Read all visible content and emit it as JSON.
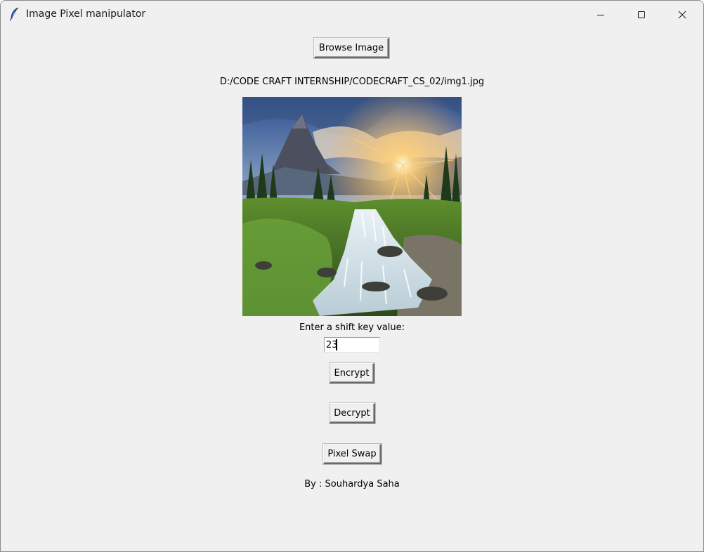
{
  "window": {
    "title": "Image Pixel manipulator"
  },
  "browse_button": {
    "label": "Browse Image"
  },
  "file_path": "D:/CODE CRAFT INTERNSHIP/CODECRAFT_CS_02/img1.jpg",
  "shift_key": {
    "label": "Enter a shift key value:",
    "value": "23"
  },
  "actions": {
    "encrypt": "Encrypt",
    "decrypt": "Decrypt",
    "pixel_swap": "Pixel Swap"
  },
  "author": "By : Souhardya Saha",
  "icons": {
    "app": "feather-icon",
    "minimize": "minimize-icon",
    "maximize": "maximize-icon",
    "close": "close-icon"
  },
  "colors": {
    "background": "#f0f0f0",
    "entry_background": "#ffffff"
  }
}
